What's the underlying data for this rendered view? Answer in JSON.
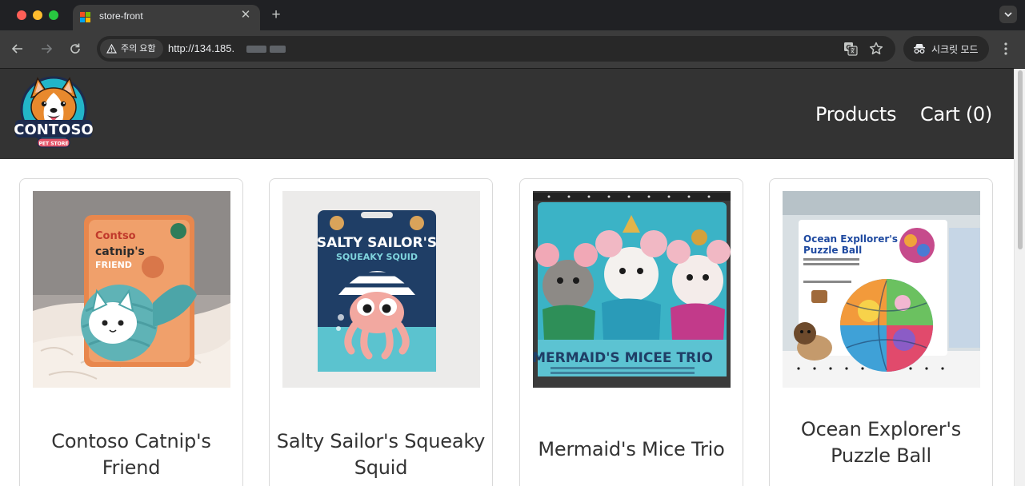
{
  "browser": {
    "tab_title": "store-front",
    "security_label": "주의 요함",
    "url": "http://134.185.",
    "profile_label": "시크릿 모드"
  },
  "site": {
    "logo_text": "CONTOSO",
    "logo_subtext": "PET STORE",
    "nav": {
      "products": "Products",
      "cart": "Cart (0)"
    }
  },
  "products": [
    {
      "name": "Contoso Catnip's Friend"
    },
    {
      "name": "Salty Sailor's Squeaky Squid"
    },
    {
      "name": "Mermaid's Mice Trio"
    },
    {
      "name": "Ocean Explorer's Puzzle Ball"
    }
  ],
  "colors": {
    "header_bg": "#333333",
    "chrome_bg": "#202124",
    "toolbar_bg": "#3c3c3c"
  }
}
